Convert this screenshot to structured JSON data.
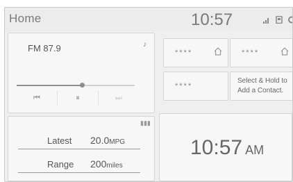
{
  "header": {
    "title": "Home",
    "clock": "10:57",
    "icons": [
      "signal-icon",
      "phone-icon",
      "settings-icon"
    ]
  },
  "radio": {
    "station": "FM  87.9",
    "progress_fraction": 0.55,
    "icon": "music-note-icon",
    "controls": [
      "seek-back-icon",
      "pause-icon",
      "seek-forward-icon"
    ]
  },
  "contacts": [
    {
      "label": "****"
    },
    {
      "label": "****"
    },
    {
      "label": "****"
    },
    {
      "hint": "Select & Hold to Add a Contact."
    }
  ],
  "energy": {
    "icon": "bar-chart-icon",
    "latest_label": "Latest",
    "latest_value": "20.0",
    "latest_unit": "MPG",
    "range_label": "Range",
    "range_value": "200",
    "range_unit": "miles"
  },
  "big_clock": {
    "time": "10:57",
    "ampm": "AM"
  }
}
